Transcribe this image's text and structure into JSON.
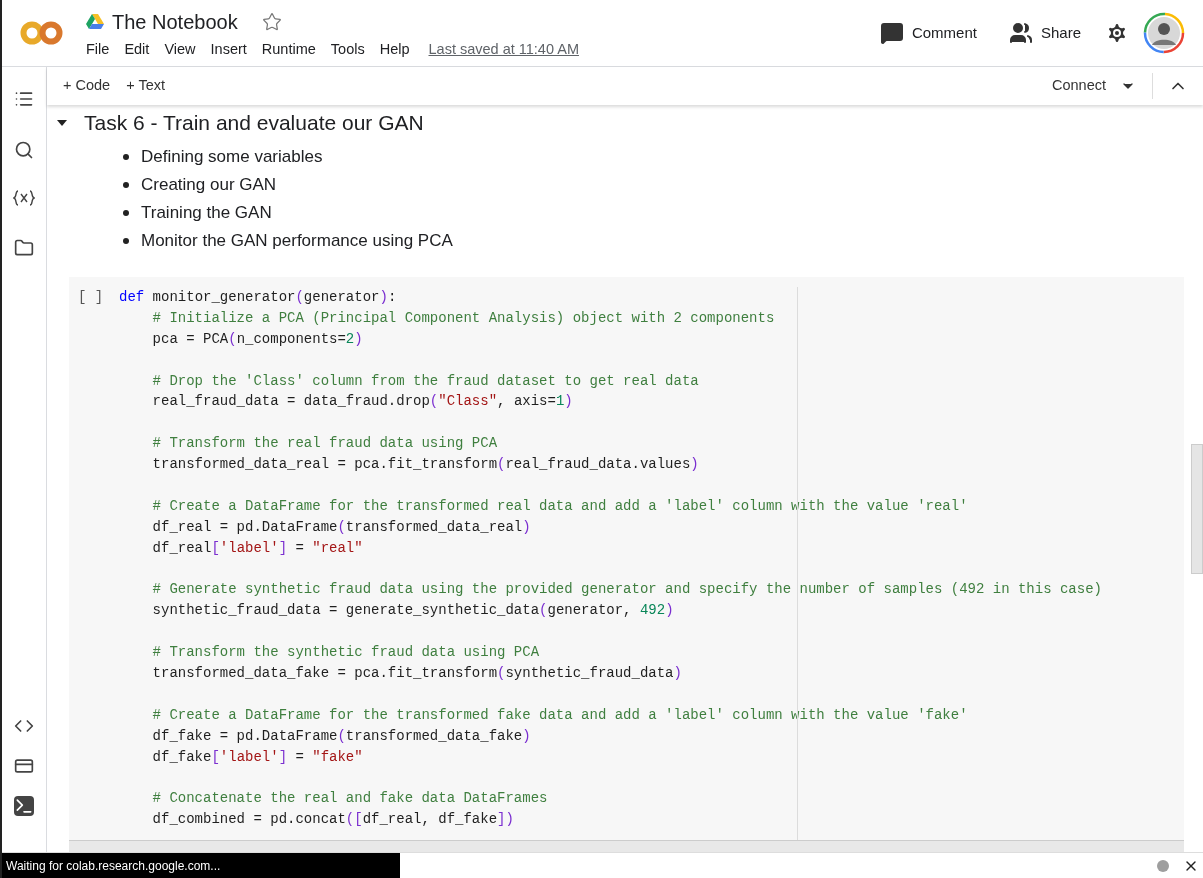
{
  "header": {
    "title": "The Notebook",
    "menu": [
      "File",
      "Edit",
      "View",
      "Insert",
      "Runtime",
      "Tools",
      "Help"
    ],
    "last_saved": "Last saved at 11:40 AM",
    "actions": [
      {
        "kind": "comment",
        "label": "Comment"
      },
      {
        "kind": "share",
        "label": "Share"
      }
    ]
  },
  "toolbar": {
    "add_buttons": [
      {
        "label": "+ Code"
      },
      {
        "label": "+ Text"
      }
    ],
    "connect": "Connect"
  },
  "section": {
    "title": "Task 6 - Train and evaluate our GAN",
    "expanded": true,
    "bullets": [
      "Defining some variables",
      "Creating our GAN",
      "Training the GAN",
      "Monitor the GAN performance using PCA"
    ]
  },
  "cell": {
    "run_marker": "[ ]",
    "lines": [
      {
        "kind": "code",
        "tokens": [
          {
            "kind": "keyword",
            "text": "def"
          },
          {
            "kind": "plain",
            "text": " monitor_generator"
          },
          {
            "kind": "bracket",
            "text": "("
          },
          {
            "kind": "plain",
            "text": "generator"
          },
          {
            "kind": "bracket",
            "text": ")"
          },
          {
            "kind": "plain",
            "text": ":"
          }
        ]
      },
      {
        "kind": "code",
        "tokens": [
          {
            "kind": "comment",
            "text": "    # Initialize a PCA (Principal Component Analysis) object with 2 components"
          }
        ]
      },
      {
        "kind": "code",
        "tokens": [
          {
            "kind": "plain",
            "text": "    pca = PCA"
          },
          {
            "kind": "bracket",
            "text": "("
          },
          {
            "kind": "plain",
            "text": "n_components="
          },
          {
            "kind": "number",
            "text": "2"
          },
          {
            "kind": "bracket",
            "text": ")"
          }
        ]
      },
      {
        "kind": "blank"
      },
      {
        "kind": "code",
        "tokens": [
          {
            "kind": "comment",
            "text": "    # Drop the 'Class' column from the fraud dataset to get real data"
          }
        ]
      },
      {
        "kind": "code",
        "tokens": [
          {
            "kind": "plain",
            "text": "    real_fraud_data = data_fraud.drop"
          },
          {
            "kind": "bracket",
            "text": "("
          },
          {
            "kind": "string",
            "text": "\"Class\""
          },
          {
            "kind": "plain",
            "text": ", axis="
          },
          {
            "kind": "number",
            "text": "1"
          },
          {
            "kind": "bracket",
            "text": ")"
          }
        ]
      },
      {
        "kind": "blank"
      },
      {
        "kind": "code",
        "tokens": [
          {
            "kind": "comment",
            "text": "    # Transform the real fraud data using PCA"
          }
        ]
      },
      {
        "kind": "code",
        "tokens": [
          {
            "kind": "plain",
            "text": "    transformed_data_real = pca.fit_transform"
          },
          {
            "kind": "bracket",
            "text": "("
          },
          {
            "kind": "plain",
            "text": "real_fraud_data.values"
          },
          {
            "kind": "bracket",
            "text": ")"
          }
        ]
      },
      {
        "kind": "blank"
      },
      {
        "kind": "code",
        "tokens": [
          {
            "kind": "comment",
            "text": "    # Create a DataFrame for the transformed real data and add a 'label' column with the value 'real'"
          }
        ]
      },
      {
        "kind": "code",
        "tokens": [
          {
            "kind": "plain",
            "text": "    df_real = pd.DataFrame"
          },
          {
            "kind": "bracket",
            "text": "("
          },
          {
            "kind": "plain",
            "text": "transformed_data_real"
          },
          {
            "kind": "bracket",
            "text": ")"
          }
        ]
      },
      {
        "kind": "code",
        "tokens": [
          {
            "kind": "plain",
            "text": "    df_real"
          },
          {
            "kind": "bracket",
            "text": "["
          },
          {
            "kind": "string",
            "text": "'label'"
          },
          {
            "kind": "bracket",
            "text": "]"
          },
          {
            "kind": "plain",
            "text": " = "
          },
          {
            "kind": "string",
            "text": "\"real\""
          }
        ]
      },
      {
        "kind": "blank"
      },
      {
        "kind": "code",
        "tokens": [
          {
            "kind": "comment",
            "text": "    # Generate synthetic fraud data using the provided generator and specify the number of samples (492 in this case)"
          }
        ]
      },
      {
        "kind": "code",
        "tokens": [
          {
            "kind": "plain",
            "text": "    synthetic_fraud_data = generate_synthetic_data"
          },
          {
            "kind": "bracket",
            "text": "("
          },
          {
            "kind": "plain",
            "text": "generator, "
          },
          {
            "kind": "number",
            "text": "492"
          },
          {
            "kind": "bracket",
            "text": ")"
          }
        ]
      },
      {
        "kind": "blank"
      },
      {
        "kind": "code",
        "tokens": [
          {
            "kind": "comment",
            "text": "    # Transform the synthetic fraud data using PCA"
          }
        ]
      },
      {
        "kind": "code",
        "tokens": [
          {
            "kind": "plain",
            "text": "    transformed_data_fake = pca.fit_transform"
          },
          {
            "kind": "bracket",
            "text": "("
          },
          {
            "kind": "plain",
            "text": "synthetic_fraud_data"
          },
          {
            "kind": "bracket",
            "text": ")"
          }
        ]
      },
      {
        "kind": "blank"
      },
      {
        "kind": "code",
        "tokens": [
          {
            "kind": "comment",
            "text": "    # Create a DataFrame for the transformed fake data and add a 'label' column with the value 'fake'"
          }
        ]
      },
      {
        "kind": "code",
        "tokens": [
          {
            "kind": "plain",
            "text": "    df_fake = pd.DataFrame"
          },
          {
            "kind": "bracket",
            "text": "("
          },
          {
            "kind": "plain",
            "text": "transformed_data_fake"
          },
          {
            "kind": "bracket",
            "text": ")"
          }
        ]
      },
      {
        "kind": "code",
        "tokens": [
          {
            "kind": "plain",
            "text": "    df_fake"
          },
          {
            "kind": "bracket",
            "text": "["
          },
          {
            "kind": "string",
            "text": "'label'"
          },
          {
            "kind": "bracket",
            "text": "]"
          },
          {
            "kind": "plain",
            "text": " = "
          },
          {
            "kind": "string",
            "text": "\"fake\""
          }
        ]
      },
      {
        "kind": "blank"
      },
      {
        "kind": "code",
        "tokens": [
          {
            "kind": "comment",
            "text": "    # Concatenate the real and fake data DataFrames"
          }
        ]
      },
      {
        "kind": "code",
        "tokens": [
          {
            "kind": "plain",
            "text": "    df_combined = pd.concat"
          },
          {
            "kind": "bracket",
            "text": "(["
          },
          {
            "kind": "plain",
            "text": "df_real, df_fake"
          },
          {
            "kind": "bracket",
            "text": "])"
          }
        ]
      }
    ]
  },
  "status": {
    "text": "Waiting for colab.research.google.com..."
  }
}
